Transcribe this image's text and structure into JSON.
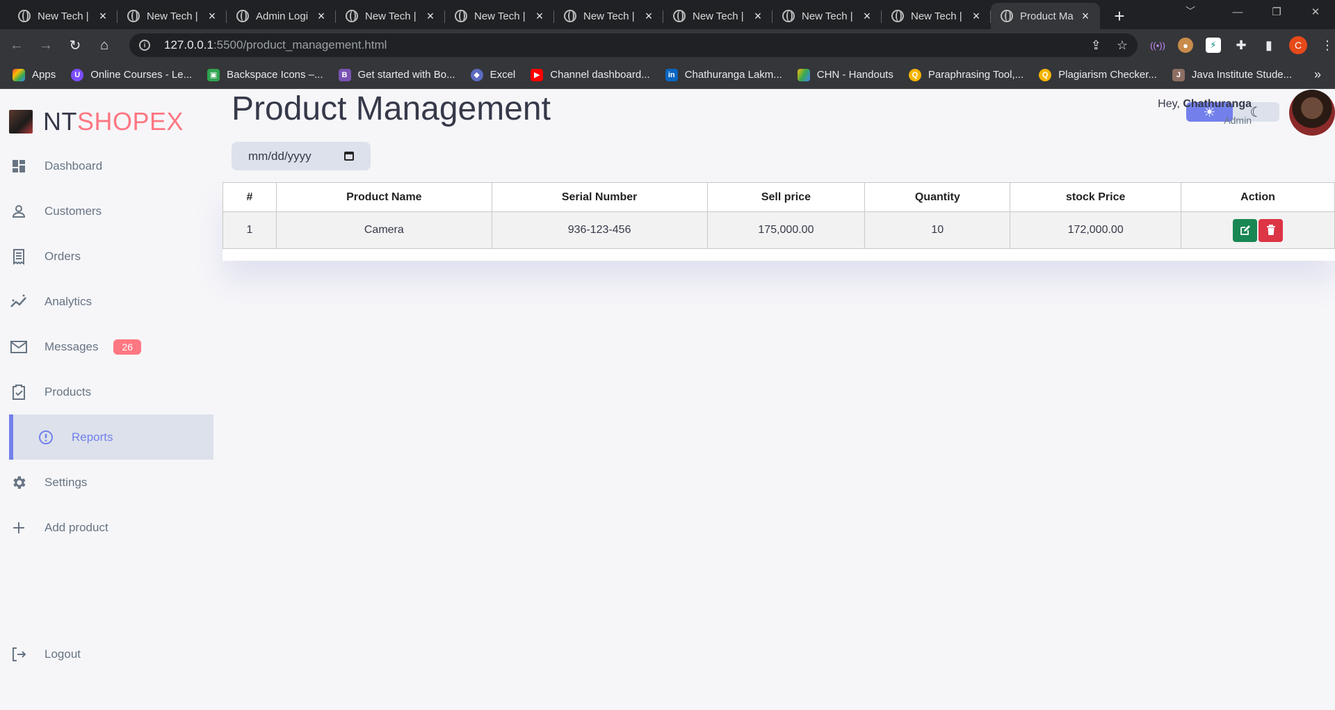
{
  "browser": {
    "tabs": [
      {
        "title": "New Tech |",
        "active": false
      },
      {
        "title": "New Tech |",
        "active": false
      },
      {
        "title": "Admin Logi",
        "active": false
      },
      {
        "title": "New Tech |",
        "active": false
      },
      {
        "title": "New Tech |",
        "active": false
      },
      {
        "title": "New Tech |",
        "active": false
      },
      {
        "title": "New Tech |",
        "active": false
      },
      {
        "title": "New Tech |",
        "active": false
      },
      {
        "title": "New Tech |",
        "active": false
      },
      {
        "title": "Product Ma",
        "active": true
      }
    ],
    "url_host": "127.0.0.1",
    "url_rest": ":5500/product_management.html",
    "profile_initial": "C",
    "bookmarks": [
      {
        "label": "Apps",
        "color": "#4285f4",
        "glyph": "⋮"
      },
      {
        "label": "Online Courses - Le...",
        "color": "#7c4dff",
        "glyph": "U"
      },
      {
        "label": "Backspace Icons –...",
        "color": "#2ea44f",
        "glyph": "B"
      },
      {
        "label": "Get started with Bo...",
        "color": "#7952b3",
        "glyph": "B"
      },
      {
        "label": "Excel",
        "color": "#5c6bc0",
        "glyph": "◆"
      },
      {
        "label": "Channel dashboard...",
        "color": "#ff0000",
        "glyph": "▶"
      },
      {
        "label": "Chathuranga Lakm...",
        "color": "#0a66c2",
        "glyph": "in"
      },
      {
        "label": "CHN - Handouts",
        "color": "#34a853",
        "glyph": "▲"
      },
      {
        "label": "Paraphrasing Tool,...",
        "color": "#f4b400",
        "glyph": "Q"
      },
      {
        "label": "Plagiarism Checker...",
        "color": "#f4b400",
        "glyph": "Q"
      },
      {
        "label": "Java Institute Stude...",
        "color": "#8d6e63",
        "glyph": "J"
      }
    ]
  },
  "sidebar": {
    "logo_a": "NT",
    "logo_b": "SHOPEX",
    "items": [
      {
        "label": "Dashboard",
        "icon": "grid-icon"
      },
      {
        "label": "Customers",
        "icon": "person-icon"
      },
      {
        "label": "Orders",
        "icon": "receipt-icon"
      },
      {
        "label": "Analytics",
        "icon": "insights-icon"
      },
      {
        "label": "Messages",
        "icon": "mail-icon",
        "badge": "26"
      },
      {
        "label": "Products",
        "icon": "inventory-icon"
      },
      {
        "label": "Reports",
        "icon": "report-icon",
        "active": true
      },
      {
        "label": "Settings",
        "icon": "gear-icon"
      },
      {
        "label": "Add product",
        "icon": "add-icon"
      }
    ],
    "logout": "Logout"
  },
  "main": {
    "title": "Product Management",
    "date_placeholder": "mm/dd/yyyy",
    "table": {
      "headers": [
        "#",
        "Product Name",
        "Serial Number",
        "Sell price",
        "Quantity",
        "stock Price",
        "Action"
      ],
      "rows": [
        {
          "no": "1",
          "name": "Camera",
          "serial": "936-123-456",
          "sell": "175,000.00",
          "qty": "10",
          "stock": "172,000.00"
        }
      ]
    }
  },
  "profile": {
    "greeting": "Hey, ",
    "name": "Chathuranga",
    "role": "Admin"
  },
  "colors": {
    "primary": "#7380ec",
    "danger": "#ff7782",
    "edit_button": "#198754",
    "delete_button": "#dc3545"
  }
}
